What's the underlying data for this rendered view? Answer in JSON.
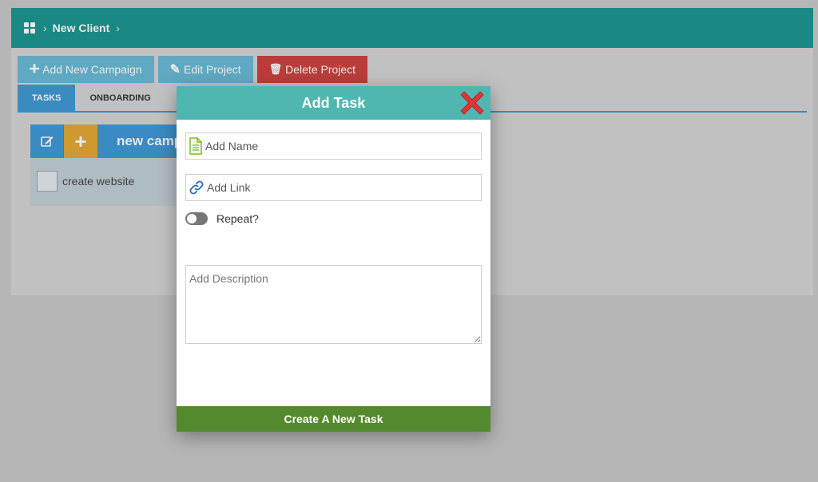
{
  "breadcrumb": {
    "current": "New Client"
  },
  "toolbar": {
    "add_campaign": "Add New Campaign",
    "edit_project": "Edit Project",
    "delete_project": "Delete Project"
  },
  "tabs": [
    {
      "label": "TASKS",
      "active": true
    },
    {
      "label": "ONBOARDING",
      "active": false
    }
  ],
  "campaign": {
    "title": "new camp",
    "tasks": [
      {
        "label": "create website",
        "checked": false
      }
    ]
  },
  "modal": {
    "title": "Add Task",
    "name_placeholder": "Add Name",
    "link_placeholder": "Add Link",
    "repeat_label": "Repeat?",
    "repeat_on": false,
    "description_placeholder": "Add Description",
    "submit_label": "Create A New Task"
  },
  "colors": {
    "header": "#068c86",
    "modal_header": "#4fb7b0",
    "primary": "#2d8fd0",
    "danger": "#c8302e",
    "success": "#548a2d",
    "accent_orange": "#e0a020"
  }
}
